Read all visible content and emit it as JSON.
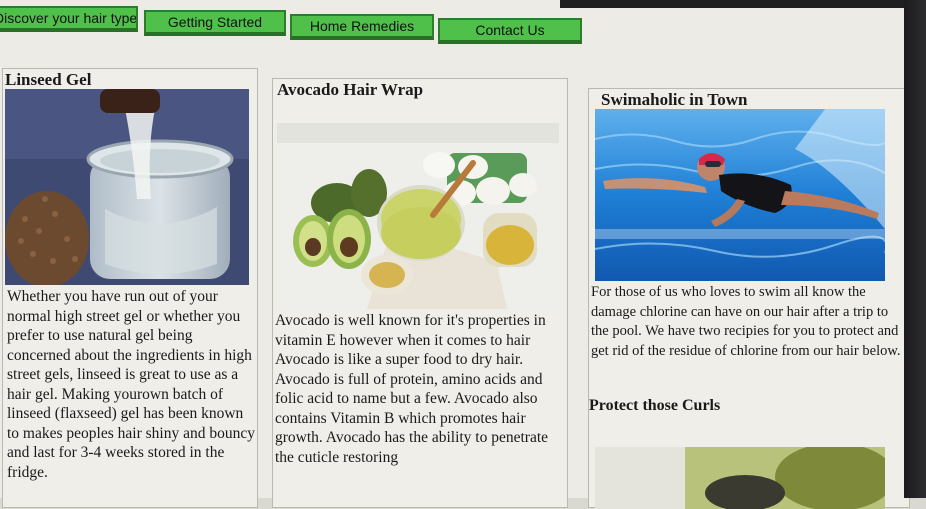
{
  "nav": {
    "items": [
      {
        "label": "Discover your hair type"
      },
      {
        "label": "Getting Started"
      },
      {
        "label": "Home Remedies"
      },
      {
        "label": "Contact Us"
      }
    ]
  },
  "columns": [
    {
      "title": "Linseed Gel",
      "text": "Whether you have run out of your normal high street gel or whether you prefer to use natural gel being concerned about the ingredients in high street gels, linseed is great to use as a hair gel. Making yourown batch of linseed (flaxseed) gel has been known to makes peoples hair shiny and bouncy and last for 3-4 weeks stored in the fridge."
    },
    {
      "title": "Avocado Hair Wrap",
      "text": "Avocado is well known for it's properties in vitamin E however when it comes to hair Avocado is like a super food to dry hair. Avocado is full of protein, amino acids and folic acid to name but a few. Avocado also contains Vitamin B which promotes hair growth. Avocado has the ability to penetrate the cuticle restoring"
    },
    {
      "title": "Swimaholic in Town",
      "text": "For those of us who loves to swim all know the damage chlorine can have on our hair after a trip to the pool. We have two recipies for you to protect and get rid of the residue of chlorine from our hair below.",
      "subheading": "Protect those Curls"
    }
  ],
  "colors": {
    "nav_green": "#4fc14a",
    "pool_blue": "#1f7fd6"
  }
}
